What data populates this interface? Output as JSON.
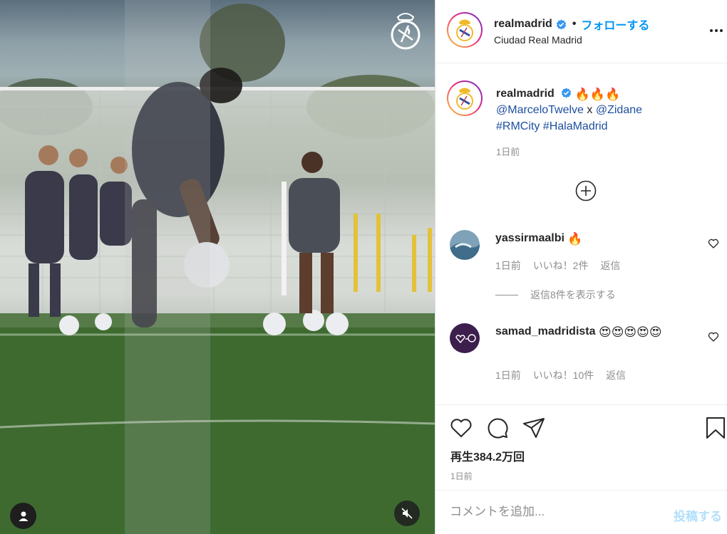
{
  "header": {
    "username": "realmadrid",
    "follow_label": "フォローする",
    "dot": "•",
    "location": "Ciudad Real Madrid"
  },
  "caption": {
    "username": "realmadrid",
    "emoji": "🔥🔥🔥",
    "mention1": "@MarceloTwelve",
    "x": "x",
    "mention2": "@Zidane",
    "hashtag1": "#RMCity",
    "hashtag2": "#HalaMadrid",
    "time": "1日前"
  },
  "comments": [
    {
      "username": "yassirmaalbi",
      "text": "🔥",
      "time": "1日前",
      "likes": "いいね！2件",
      "reply": "返信"
    },
    {
      "username": "samad_madridista",
      "text": "😍😍😍😍😍",
      "time": "1日前",
      "likes": "いいね！10件",
      "reply": "返信"
    }
  ],
  "view_replies": "返信8件を表示する",
  "stats": {
    "views": "再生384.2万回",
    "time": "1日前"
  },
  "comment_box": {
    "placeholder": "コメントを追加...",
    "post_label": "投稿する"
  },
  "colors": {
    "accent": "#0095f6",
    "link": "#1d4f9e",
    "muted": "#8e8e8e",
    "post_disabled": "#b2dffc"
  },
  "icons": [
    "verified-badge-icon",
    "more-options-icon",
    "add-circle-icon",
    "heart-icon",
    "comment-icon",
    "share-icon",
    "bookmark-icon",
    "user-tag-icon",
    "muted-speaker-icon"
  ]
}
